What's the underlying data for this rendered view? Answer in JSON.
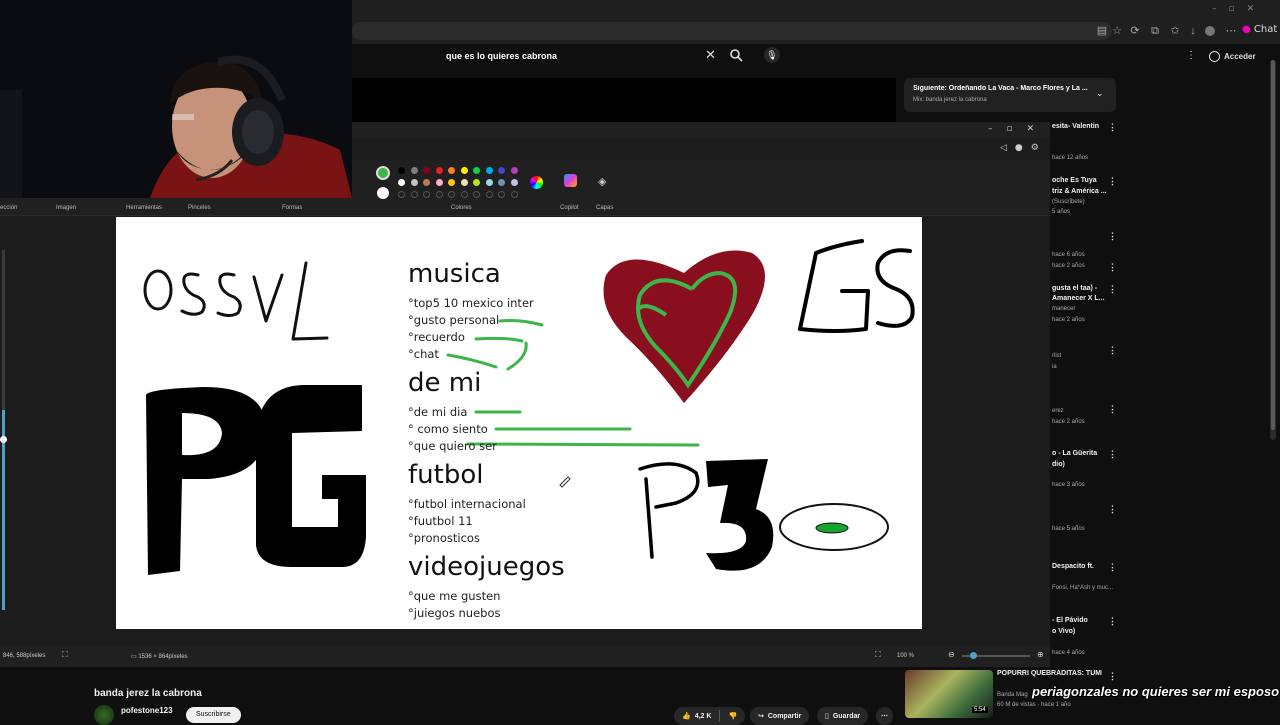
{
  "search": {
    "query": "que es lo quieres cabrona"
  },
  "header": {
    "login_label": "Acceder",
    "chat_label": "Chat"
  },
  "next_up": {
    "title": "Siguiente: Ordeñando La Vaca - Marco Flores y La ...",
    "subtitle": "Mix: banda jerez la cabrona"
  },
  "sidebar": {
    "items": [
      {
        "title": "esita- Valentin",
        "meta": ""
      },
      {
        "title": "",
        "meta": "hace 12 años"
      },
      {
        "title": "oche Es Tuya",
        "meta": ""
      },
      {
        "title": "triz & América ...",
        "meta": ""
      },
      {
        "title": "",
        "meta": "(Suscríbete)"
      },
      {
        "title": "",
        "meta": "5 años"
      },
      {
        "title": "",
        "meta": "hace 6 años"
      },
      {
        "title": "",
        "meta": "hace 2 años"
      },
      {
        "title": "gusta el taa) -",
        "meta": ""
      },
      {
        "title": "Amanecer X L...",
        "meta": ""
      },
      {
        "title": "",
        "meta": "manecer"
      },
      {
        "title": "",
        "meta": "hace 2 años"
      },
      {
        "title": "",
        "meta": "rlist"
      },
      {
        "title": "",
        "meta": "ia"
      },
      {
        "title": "",
        "meta": "erez"
      },
      {
        "title": "",
        "meta": "hace 2 años"
      },
      {
        "title": "o - La Güerita",
        "meta": ""
      },
      {
        "title": "dio)",
        "meta": ""
      },
      {
        "title": "",
        "meta": "hace 3 años"
      },
      {
        "title": "",
        "meta": "hace 5 años"
      },
      {
        "title": "Despacito ft.",
        "meta": ""
      },
      {
        "title": "",
        "meta": "Fonsi, Ha*Ash y muc..."
      },
      {
        "title": "- El Pávido",
        "meta": ""
      },
      {
        "title": "o Vivo)",
        "meta": ""
      },
      {
        "title": "",
        "meta": "hace 4 años"
      }
    ]
  },
  "paint": {
    "ribbon": {
      "labels": [
        "ección",
        "Imagen",
        "Herramientas",
        "Pinceles",
        "Formas",
        "Colores",
        "Copilot",
        "Capas"
      ]
    },
    "status": {
      "position": "846, 588píxeles",
      "size": "1536 × 864píxeles",
      "zoom": "100 %"
    }
  },
  "canvas": {
    "sections": [
      {
        "heading": "musica",
        "items": [
          "°top5 10 mexico inter",
          "°gusto personal",
          "°recuerdo",
          "°chat"
        ]
      },
      {
        "heading": "de mi",
        "items": [
          "°de mi dia",
          "° como siento",
          "°que quiero ser"
        ]
      },
      {
        "heading": "futbol",
        "items": [
          "°futbol internacional",
          "°fuutbol 11",
          "°pronosticos"
        ]
      },
      {
        "heading": "videojuegos",
        "items": [
          "°que me gusten",
          "°juiegos nuebos"
        ]
      }
    ]
  },
  "video": {
    "title": "banda jerez la cabrona",
    "channel": "pofestone123",
    "subscribe_label": "Suscribirse",
    "likes": "4,2 K",
    "share_label": "Compartir",
    "save_label": "Guardar"
  },
  "mix_card": {
    "title": "POPURRÍ QUEBRADITAS: TUMBANDO CAÑA - COMO LA...",
    "channel": "Banda Mag",
    "meta": "60 M de vistas · hace 1 año",
    "duration": "5:54"
  },
  "chat_overlay": {
    "user": "periagonzales",
    "message": "no quieres ser mi esposo?"
  },
  "colors": {
    "paint_green": "#3cb54a",
    "paint_dark_red": "#8a0f1e",
    "bg": "#0f0f0f"
  }
}
